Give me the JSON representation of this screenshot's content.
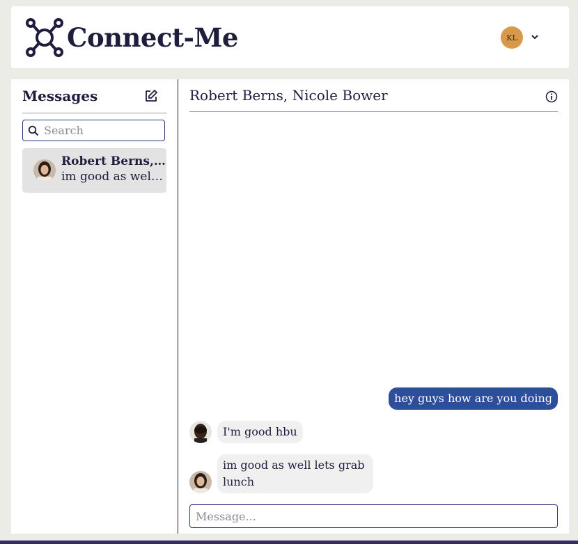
{
  "header": {
    "brand": "Connect-Me",
    "logo_icon": "network-nodes-icon",
    "user_initials": "KL",
    "menu_icon": "chevron-down-icon"
  },
  "sidebar": {
    "title": "Messages",
    "compose_icon": "compose-icon",
    "search": {
      "placeholder": "Search",
      "value": ""
    },
    "conversations": [
      {
        "name": "Robert Berns, Nicole Bower",
        "preview": "im good as well lets grab lunch",
        "selected": true
      }
    ]
  },
  "chat": {
    "title": "Robert Berns, Nicole Bower",
    "info_icon": "info-icon",
    "messages": [
      {
        "direction": "outgoing",
        "text": "hey guys how are you doing"
      },
      {
        "direction": "incoming",
        "sender": "Robert Berns",
        "text": "I'm good hbu"
      },
      {
        "direction": "incoming",
        "sender": "Nicole Bower",
        "text": "im good as well lets grab lunch"
      }
    ],
    "composer": {
      "placeholder": "Message...",
      "value": ""
    }
  },
  "colors": {
    "page_bg": "#ecece7",
    "text": "#1f1d3d",
    "accent": "#2d4e9a",
    "avatar_user": "#d89a4a",
    "selected_conv": "#e3e3e3",
    "bubble_in": "#f0f0f0"
  }
}
